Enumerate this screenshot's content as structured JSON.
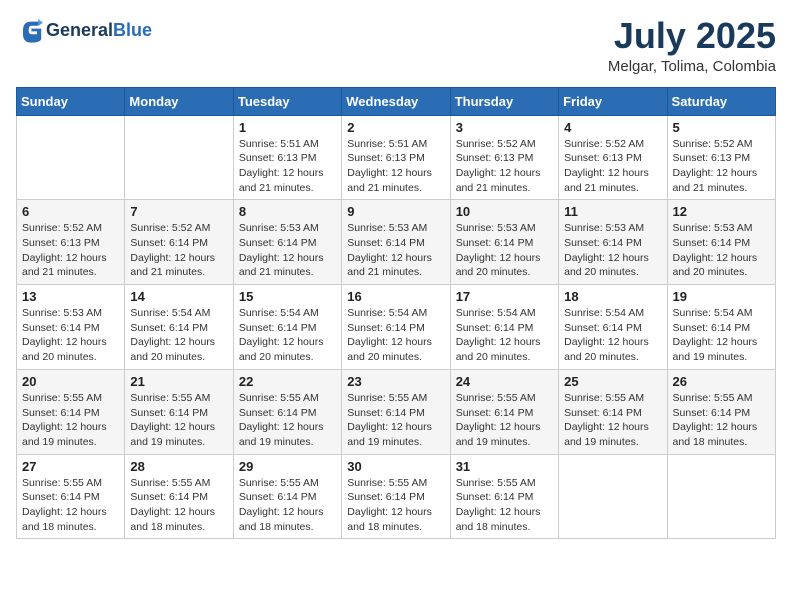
{
  "header": {
    "logo_general": "General",
    "logo_blue": "Blue",
    "title": "July 2025",
    "location": "Melgar, Tolima, Colombia"
  },
  "calendar": {
    "days_of_week": [
      "Sunday",
      "Monday",
      "Tuesday",
      "Wednesday",
      "Thursday",
      "Friday",
      "Saturday"
    ],
    "weeks": [
      [
        {
          "day": "",
          "info": ""
        },
        {
          "day": "",
          "info": ""
        },
        {
          "day": "1",
          "info": "Sunrise: 5:51 AM\nSunset: 6:13 PM\nDaylight: 12 hours and 21 minutes."
        },
        {
          "day": "2",
          "info": "Sunrise: 5:51 AM\nSunset: 6:13 PM\nDaylight: 12 hours and 21 minutes."
        },
        {
          "day": "3",
          "info": "Sunrise: 5:52 AM\nSunset: 6:13 PM\nDaylight: 12 hours and 21 minutes."
        },
        {
          "day": "4",
          "info": "Sunrise: 5:52 AM\nSunset: 6:13 PM\nDaylight: 12 hours and 21 minutes."
        },
        {
          "day": "5",
          "info": "Sunrise: 5:52 AM\nSunset: 6:13 PM\nDaylight: 12 hours and 21 minutes."
        }
      ],
      [
        {
          "day": "6",
          "info": "Sunrise: 5:52 AM\nSunset: 6:13 PM\nDaylight: 12 hours and 21 minutes."
        },
        {
          "day": "7",
          "info": "Sunrise: 5:52 AM\nSunset: 6:14 PM\nDaylight: 12 hours and 21 minutes."
        },
        {
          "day": "8",
          "info": "Sunrise: 5:53 AM\nSunset: 6:14 PM\nDaylight: 12 hours and 21 minutes."
        },
        {
          "day": "9",
          "info": "Sunrise: 5:53 AM\nSunset: 6:14 PM\nDaylight: 12 hours and 21 minutes."
        },
        {
          "day": "10",
          "info": "Sunrise: 5:53 AM\nSunset: 6:14 PM\nDaylight: 12 hours and 20 minutes."
        },
        {
          "day": "11",
          "info": "Sunrise: 5:53 AM\nSunset: 6:14 PM\nDaylight: 12 hours and 20 minutes."
        },
        {
          "day": "12",
          "info": "Sunrise: 5:53 AM\nSunset: 6:14 PM\nDaylight: 12 hours and 20 minutes."
        }
      ],
      [
        {
          "day": "13",
          "info": "Sunrise: 5:53 AM\nSunset: 6:14 PM\nDaylight: 12 hours and 20 minutes."
        },
        {
          "day": "14",
          "info": "Sunrise: 5:54 AM\nSunset: 6:14 PM\nDaylight: 12 hours and 20 minutes."
        },
        {
          "day": "15",
          "info": "Sunrise: 5:54 AM\nSunset: 6:14 PM\nDaylight: 12 hours and 20 minutes."
        },
        {
          "day": "16",
          "info": "Sunrise: 5:54 AM\nSunset: 6:14 PM\nDaylight: 12 hours and 20 minutes."
        },
        {
          "day": "17",
          "info": "Sunrise: 5:54 AM\nSunset: 6:14 PM\nDaylight: 12 hours and 20 minutes."
        },
        {
          "day": "18",
          "info": "Sunrise: 5:54 AM\nSunset: 6:14 PM\nDaylight: 12 hours and 20 minutes."
        },
        {
          "day": "19",
          "info": "Sunrise: 5:54 AM\nSunset: 6:14 PM\nDaylight: 12 hours and 19 minutes."
        }
      ],
      [
        {
          "day": "20",
          "info": "Sunrise: 5:55 AM\nSunset: 6:14 PM\nDaylight: 12 hours and 19 minutes."
        },
        {
          "day": "21",
          "info": "Sunrise: 5:55 AM\nSunset: 6:14 PM\nDaylight: 12 hours and 19 minutes."
        },
        {
          "day": "22",
          "info": "Sunrise: 5:55 AM\nSunset: 6:14 PM\nDaylight: 12 hours and 19 minutes."
        },
        {
          "day": "23",
          "info": "Sunrise: 5:55 AM\nSunset: 6:14 PM\nDaylight: 12 hours and 19 minutes."
        },
        {
          "day": "24",
          "info": "Sunrise: 5:55 AM\nSunset: 6:14 PM\nDaylight: 12 hours and 19 minutes."
        },
        {
          "day": "25",
          "info": "Sunrise: 5:55 AM\nSunset: 6:14 PM\nDaylight: 12 hours and 19 minutes."
        },
        {
          "day": "26",
          "info": "Sunrise: 5:55 AM\nSunset: 6:14 PM\nDaylight: 12 hours and 18 minutes."
        }
      ],
      [
        {
          "day": "27",
          "info": "Sunrise: 5:55 AM\nSunset: 6:14 PM\nDaylight: 12 hours and 18 minutes."
        },
        {
          "day": "28",
          "info": "Sunrise: 5:55 AM\nSunset: 6:14 PM\nDaylight: 12 hours and 18 minutes."
        },
        {
          "day": "29",
          "info": "Sunrise: 5:55 AM\nSunset: 6:14 PM\nDaylight: 12 hours and 18 minutes."
        },
        {
          "day": "30",
          "info": "Sunrise: 5:55 AM\nSunset: 6:14 PM\nDaylight: 12 hours and 18 minutes."
        },
        {
          "day": "31",
          "info": "Sunrise: 5:55 AM\nSunset: 6:14 PM\nDaylight: 12 hours and 18 minutes."
        },
        {
          "day": "",
          "info": ""
        },
        {
          "day": "",
          "info": ""
        }
      ]
    ]
  }
}
